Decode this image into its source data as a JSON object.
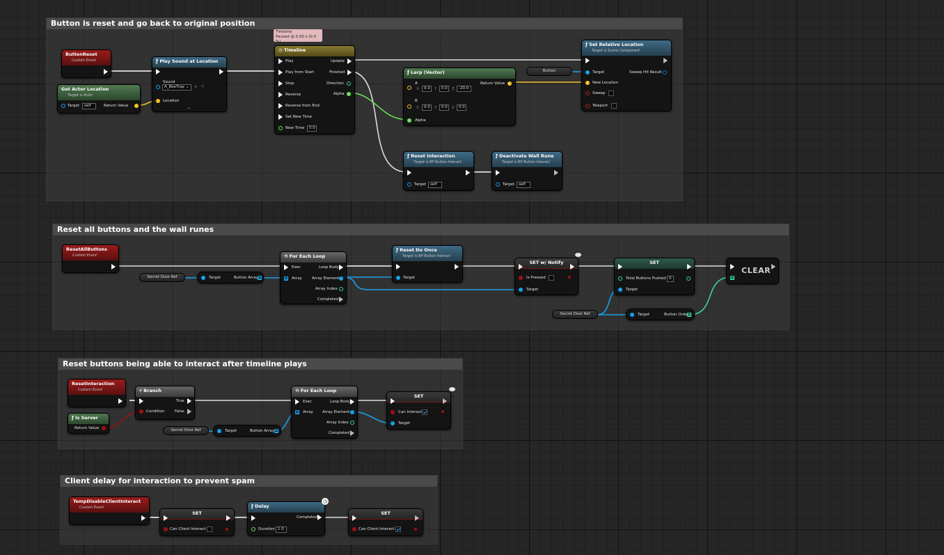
{
  "comments": [
    {
      "title": "Button is reset and go back to original position"
    },
    {
      "title": "Reset all buttons and the wall runes"
    },
    {
      "title": "Reset buttons being able to interact after timeline plays"
    },
    {
      "title": "Client delay for interaction to prevent spam"
    }
  ],
  "section1": {
    "button_reset": {
      "title": "ButtonReset",
      "subtitle": "Custom Event"
    },
    "get_actor_location": {
      "title": "Get Actor Location",
      "subtitle": "Target is Actor",
      "target": "Target",
      "target_value": "self",
      "return_value": "Return Value"
    },
    "play_sound": {
      "title": "Play Sound at Location",
      "sound_label": "Sound",
      "sound_value": "A_BeeTrap",
      "location_label": "Location"
    },
    "timeline_tag": {
      "line1": "Timeline",
      "line2": "Paused @ 0.00 s (0.0 %)"
    },
    "timeline": {
      "title": "Timeline",
      "inputs": [
        "Play",
        "Play from Start",
        "Stop",
        "Reverse",
        "Reverse from End",
        "Set New Time",
        "New Time"
      ],
      "new_time_value": "0.0",
      "outputs": [
        "Update",
        "Finished",
        "Direction",
        "Alpha"
      ]
    },
    "lerp": {
      "title": "Lerp (Vector)",
      "a_label": "A",
      "a_x": "0.0",
      "a_y": "0.0",
      "a_z": "-20.0",
      "b_label": "B",
      "b_x": "0.0",
      "b_y": "0.0",
      "b_z": "0.0",
      "alpha_label": "Alpha",
      "return_value": "Return Value",
      "x": "X",
      "y": "Y",
      "z": "Z"
    },
    "button_var": "Button",
    "set_relative_location": {
      "title": "Set Relative Location",
      "subtitle": "Target is Scene Component",
      "target": "Target",
      "new_location": "New Location",
      "sweep": "Sweep",
      "teleport": "Teleport",
      "sweep_hit": "Sweep Hit Result"
    },
    "reset_interaction": {
      "title": "Reset Interaction",
      "subtitle": "Target is BP Button Interact",
      "target": "Target",
      "target_value": "self"
    },
    "deactivate_wall_rune": {
      "title": "Deactivate Wall Rune",
      "subtitle": "Target is BP Button Interact",
      "target": "Target",
      "target_value": "self"
    }
  },
  "section2": {
    "reset_all_buttons": {
      "title": "ResetAllButtons",
      "subtitle": "Custom Event"
    },
    "secret_door_ref": "Secret Door Ref",
    "get_button_array": {
      "target": "Target",
      "out": "Button Array"
    },
    "for_each": {
      "title": "For Each Loop",
      "exec": "Exec",
      "array": "Array",
      "loop_body": "Loop Body",
      "array_element": "Array Element",
      "array_index": "Array Index",
      "completed": "Completed"
    },
    "reset_do_once": {
      "title": "Reset Do Once",
      "subtitle": "Target is BP Button Interact",
      "target": "Target"
    },
    "set_notify": {
      "title": "SET w/ Notify",
      "is_pressed": "Is Pressed",
      "target": "Target"
    },
    "set_total": {
      "title": "SET",
      "total": "Total Buttons Pushed",
      "total_value": "0",
      "target": "Target"
    },
    "clear": "CLEAR",
    "secret_door_ref2": "Secret Door Ref",
    "get_button_order": {
      "target": "Target",
      "out": "Button Order"
    }
  },
  "section3": {
    "reset_interaction_event": {
      "title": "ResetInteraction",
      "subtitle": "Custom Event"
    },
    "is_server": {
      "title": "Is Server",
      "return_value": "Return Value"
    },
    "branch": {
      "title": "Branch",
      "condition": "Condition",
      "true": "True",
      "false": "False"
    },
    "secret_door_ref": "Secret Door Ref",
    "get_button_array": {
      "target": "Target",
      "out": "Button Array"
    },
    "for_each": {
      "title": "For Each Loop",
      "exec": "Exec",
      "array": "Array",
      "loop_body": "Loop Body",
      "array_element": "Array Element",
      "array_index": "Array Index",
      "completed": "Completed"
    },
    "set_can_interact": {
      "title": "SET",
      "can_interact": "Can Interact",
      "target": "Target"
    }
  },
  "section4": {
    "temp_disable": {
      "title": "TempDisableClientInteract",
      "subtitle": "Custom Event"
    },
    "set1": {
      "title": "SET",
      "label": "Can Client Interact"
    },
    "delay": {
      "title": "Delay",
      "duration": "Duration",
      "duration_value": "1.0",
      "completed": "Completed"
    },
    "set2": {
      "title": "SET",
      "label": "Can Client Interact"
    }
  },
  "colors": {
    "exec": "#ffffff",
    "object": "#1aa0e8",
    "vector": "#f6c22c",
    "float": "#6be05a",
    "bool": "#a01010",
    "int": "#3ad6a0"
  }
}
